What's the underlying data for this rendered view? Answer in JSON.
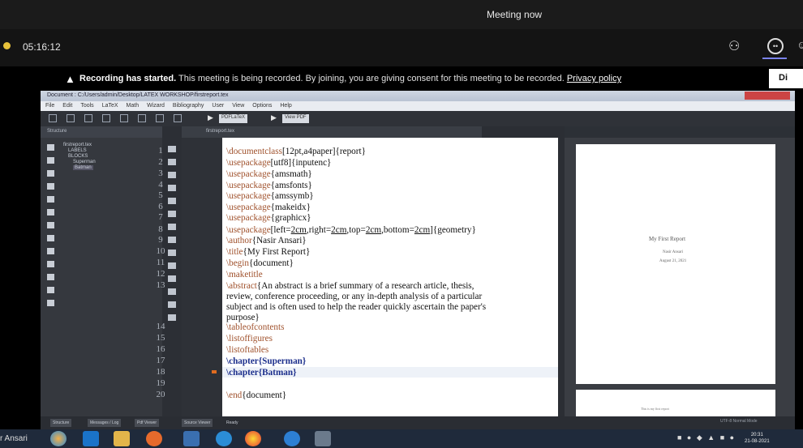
{
  "meeting": {
    "title": "Meeting now",
    "timer": "05:16:12",
    "recording": {
      "bold": "Recording has started.",
      "text": " This meeting is being recorded. By joining, you are giving consent for this meeting to be recorded. ",
      "link": "Privacy policy",
      "dismiss_label": "Di"
    },
    "participant_name": "r Ansari"
  },
  "editor": {
    "window_title": "Document : C:/Users/admin/Desktop/LATEX WORKSHOP/firstreport.tex",
    "menu": [
      "File",
      "Edit",
      "Tools",
      "LaTeX",
      "Math",
      "Wizard",
      "Bibliography",
      "User",
      "View",
      "Options",
      "Help"
    ],
    "toolbar": {
      "compile": "PDFLaTeX",
      "view": "View PDF"
    },
    "structure_header": "Structure",
    "tree": [
      "firstreport.tex",
      "LABELS",
      "BLOCKS",
      "Superman",
      "Batman"
    ],
    "tab_label": "firstreport.tex",
    "line_numbers": [
      "1",
      "2",
      "3",
      "4",
      "5",
      "6",
      "7",
      "8",
      "9",
      "10",
      "11",
      "12",
      "13",
      "14",
      "15",
      "16",
      "17",
      "18",
      "19",
      "20"
    ],
    "status_tabs": [
      "Structure",
      "Messages / Log",
      "Pdf Viewer",
      "Source Viewer",
      "Ready"
    ],
    "status_right": "UTF-8  Normal Mode"
  },
  "pdf": {
    "title": "My First Report",
    "author": "Nasir Ansari",
    "date": "August 21, 2021",
    "abstract_preview": "This is my first report"
  },
  "taskbar": {
    "time": "20:31",
    "date": "21-08-2021"
  }
}
